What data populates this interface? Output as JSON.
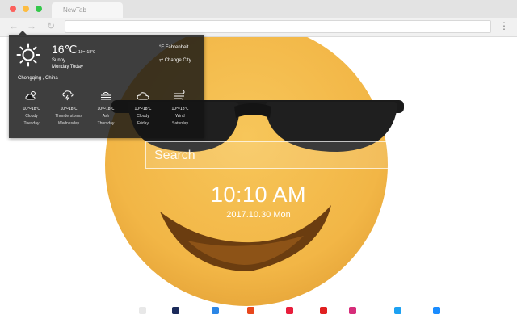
{
  "browser": {
    "tab_title": "NewTab",
    "traffic_lights": [
      "#fc605c",
      "#fdbc40",
      "#34c84a"
    ]
  },
  "page": {
    "clock": "10:10 AM",
    "date": "2017.10.30 Mon",
    "search_placeholder": "Search",
    "face_color": "#f2b646"
  },
  "weather": {
    "temperature": "16℃",
    "temp_range": "10～18℃",
    "condition": "Sunny",
    "today": "Monday Today",
    "fahrenheit": "°F  Fahrenheit",
    "change_city": "⇄  Change City",
    "location": "Chongqing , China",
    "forecast": [
      {
        "icon": "cloud-sun-icon",
        "range": "10～18℃",
        "condition": "Cloudy",
        "day": "Tuesday"
      },
      {
        "icon": "thunderstorm-icon",
        "range": "10～18℃",
        "condition": "Thunderstorms",
        "day": "Wednesday"
      },
      {
        "icon": "ash-icon",
        "range": "10～18℃",
        "condition": "Ash",
        "day": "Thursday"
      },
      {
        "icon": "cloud-icon",
        "range": "10～18℃",
        "condition": "Cloudy",
        "day": "Friday"
      },
      {
        "icon": "wind-icon",
        "range": "10～18℃",
        "condition": "Wind",
        "day": "Saturday"
      }
    ]
  },
  "dock": {
    "icons": [
      {
        "name": "dock-icon-1",
        "color": "#e8e8e8"
      },
      {
        "name": "dock-icon-2",
        "color": "#1b2a5a"
      },
      {
        "name": "dock-icon-3",
        "color": "#2b86e6"
      },
      {
        "name": "dock-icon-4",
        "color": "#e8471c"
      },
      {
        "name": "dock-icon-5",
        "color": "#e81e3c"
      },
      {
        "name": "dock-icon-6",
        "color": "#e02020"
      },
      {
        "name": "dock-icon-7",
        "color": "#d62d7a"
      },
      {
        "name": "dock-icon-8",
        "color": "#1da1f2"
      },
      {
        "name": "dock-icon-9",
        "color": "#1a8cff"
      }
    ]
  }
}
